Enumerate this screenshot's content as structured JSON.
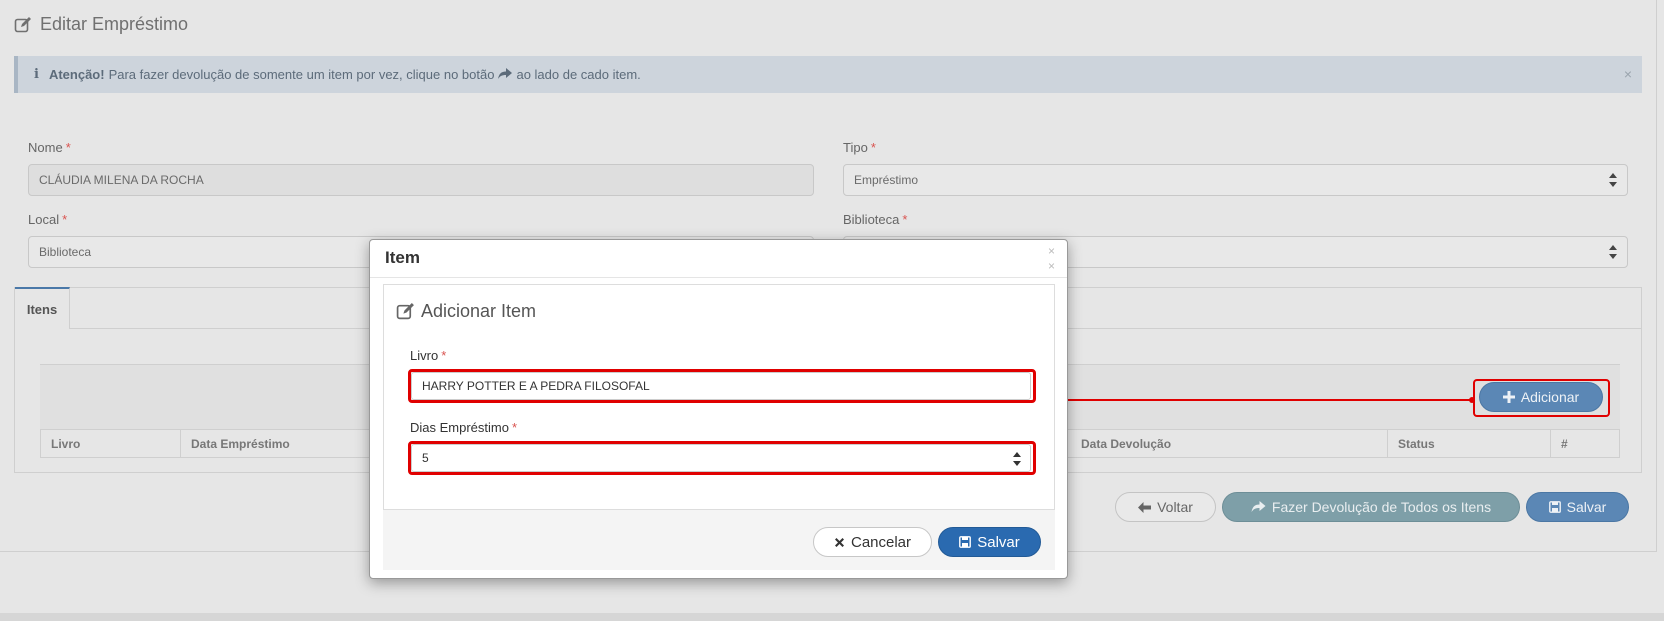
{
  "page": {
    "title": "Editar Empréstimo"
  },
  "alert": {
    "info_glyph": "i",
    "strong": "Atenção!",
    "text_before": "Para fazer devolução de somente um item por vez, clique no botão",
    "text_after": "ao lado de cado item.",
    "close": "×"
  },
  "form": {
    "nome_label": "Nome",
    "nome_value": "CLÁUDIA MILENA DA ROCHA",
    "tipo_label": "Tipo",
    "tipo_value": "Empréstimo",
    "local_label": "Local",
    "local_value": "Biblioteca",
    "biblioteca_label": "Biblioteca",
    "required_mark": "*"
  },
  "tabs": {
    "itens": "Itens"
  },
  "table": {
    "headers": [
      "Livro",
      "Data Empréstimo",
      "Data Devolução",
      "Status",
      "#"
    ]
  },
  "buttons": {
    "adicionar": "Adicionar",
    "voltar": "Voltar",
    "fazer_devolucao": "Fazer Devolução de Todos os Itens",
    "salvar": "Salvar"
  },
  "modal": {
    "title": "Item",
    "close": "×",
    "card_title": "Adicionar Item",
    "livro_label": "Livro",
    "livro_value": "HARRY POTTER E A PEDRA FILOSOFAL",
    "dias_label": "Dias Empréstimo",
    "dias_value": "5",
    "cancel_label": "Cancelar",
    "save_label": "Salvar"
  },
  "colors": {
    "highlight": "#e00000",
    "primary": "#2a6ab0",
    "required": "#d9534f"
  }
}
